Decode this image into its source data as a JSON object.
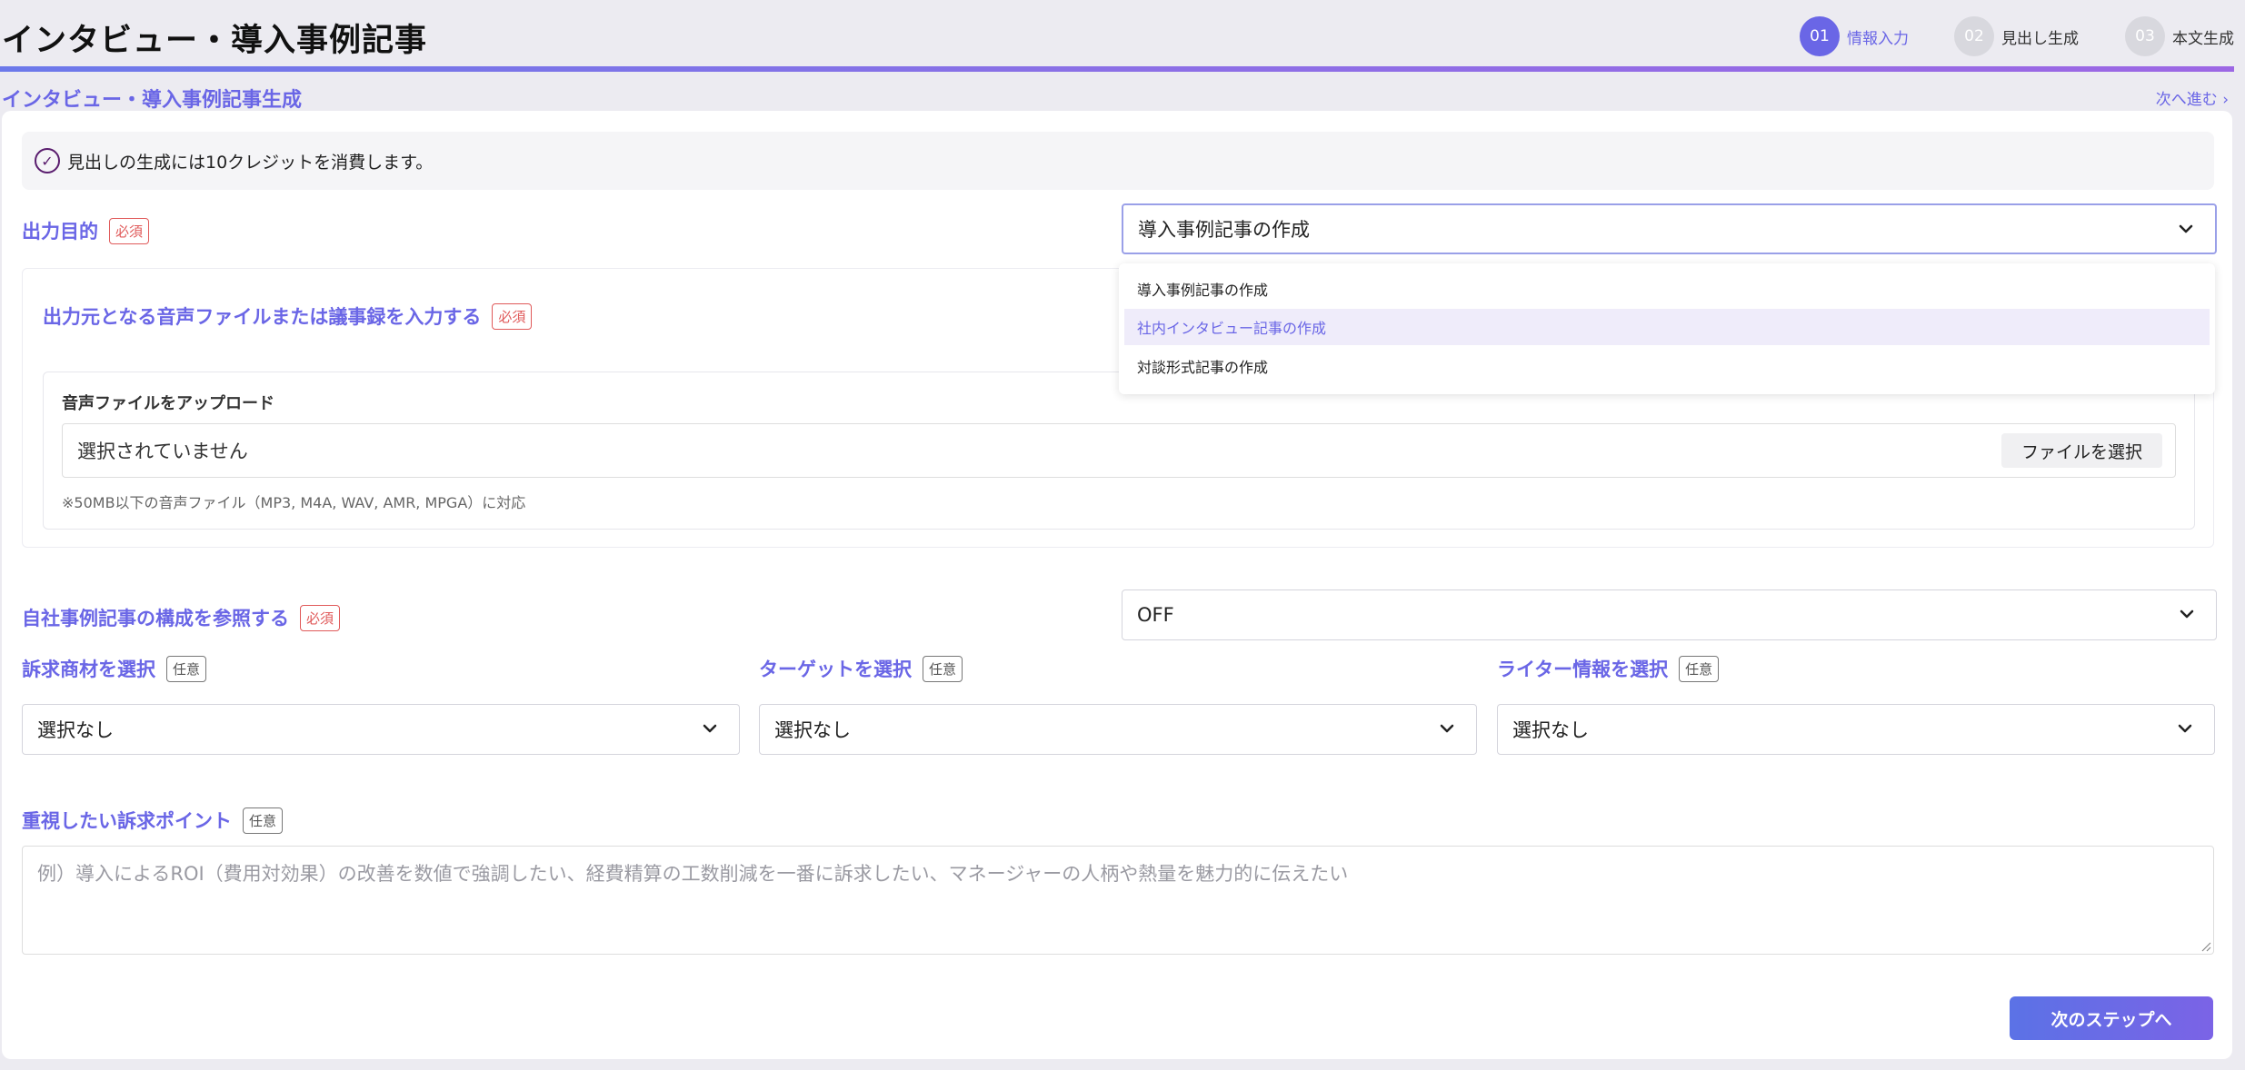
{
  "header": {
    "title": "インタビュー・導入事例記事",
    "steps": [
      {
        "num": "01",
        "label": "情報入力",
        "active": true
      },
      {
        "num": "02",
        "label": "見出し生成",
        "active": false
      },
      {
        "num": "03",
        "label": "本文生成",
        "active": false
      }
    ]
  },
  "section": {
    "title": "インタビュー・導入事例記事生成",
    "next_link": "次へ進む ›"
  },
  "notice": {
    "icon": "check-circle-icon",
    "text": "見出しの生成には10クレジットを消費します。"
  },
  "badges": {
    "required": "必須",
    "optional": "任意"
  },
  "purpose": {
    "label": "出力目的",
    "selected": "導入事例記事の作成",
    "options": [
      "導入事例記事の作成",
      "社内インタビュー記事の作成",
      "対談形式記事の作成"
    ],
    "highlighted_index": 1
  },
  "source": {
    "label": "出力元となる音声ファイルまたは議事録を入力する",
    "upload_title": "音声ファイルをアップロード",
    "file_status": "選択されていません",
    "file_button": "ファイルを選択",
    "note": "※50MB以下の音声ファイル（MP3, M4A, WAV, AMR, MPGA）に対応"
  },
  "reference": {
    "label": "自社事例記事の構成を参照する",
    "selected": "OFF"
  },
  "product": {
    "label": "訴求商材を選択",
    "selected": "選択なし"
  },
  "target": {
    "label": "ターゲットを選択",
    "selected": "選択なし"
  },
  "writer": {
    "label": "ライター情報を選択",
    "selected": "選択なし"
  },
  "points": {
    "label": "重視したい訴求ポイント",
    "placeholder": "例）導入によるROI（費用対効果）の改善を数値で強調したい、経費精算の工数削減を一番に訴求したい、マネージャーの人柄や熱量を魅力的に伝えたい"
  },
  "footer": {
    "next_button": "次のステップへ"
  },
  "colors": {
    "accent": "#6a66e6",
    "required": "#e05a5a",
    "background": "#ecebf1"
  }
}
